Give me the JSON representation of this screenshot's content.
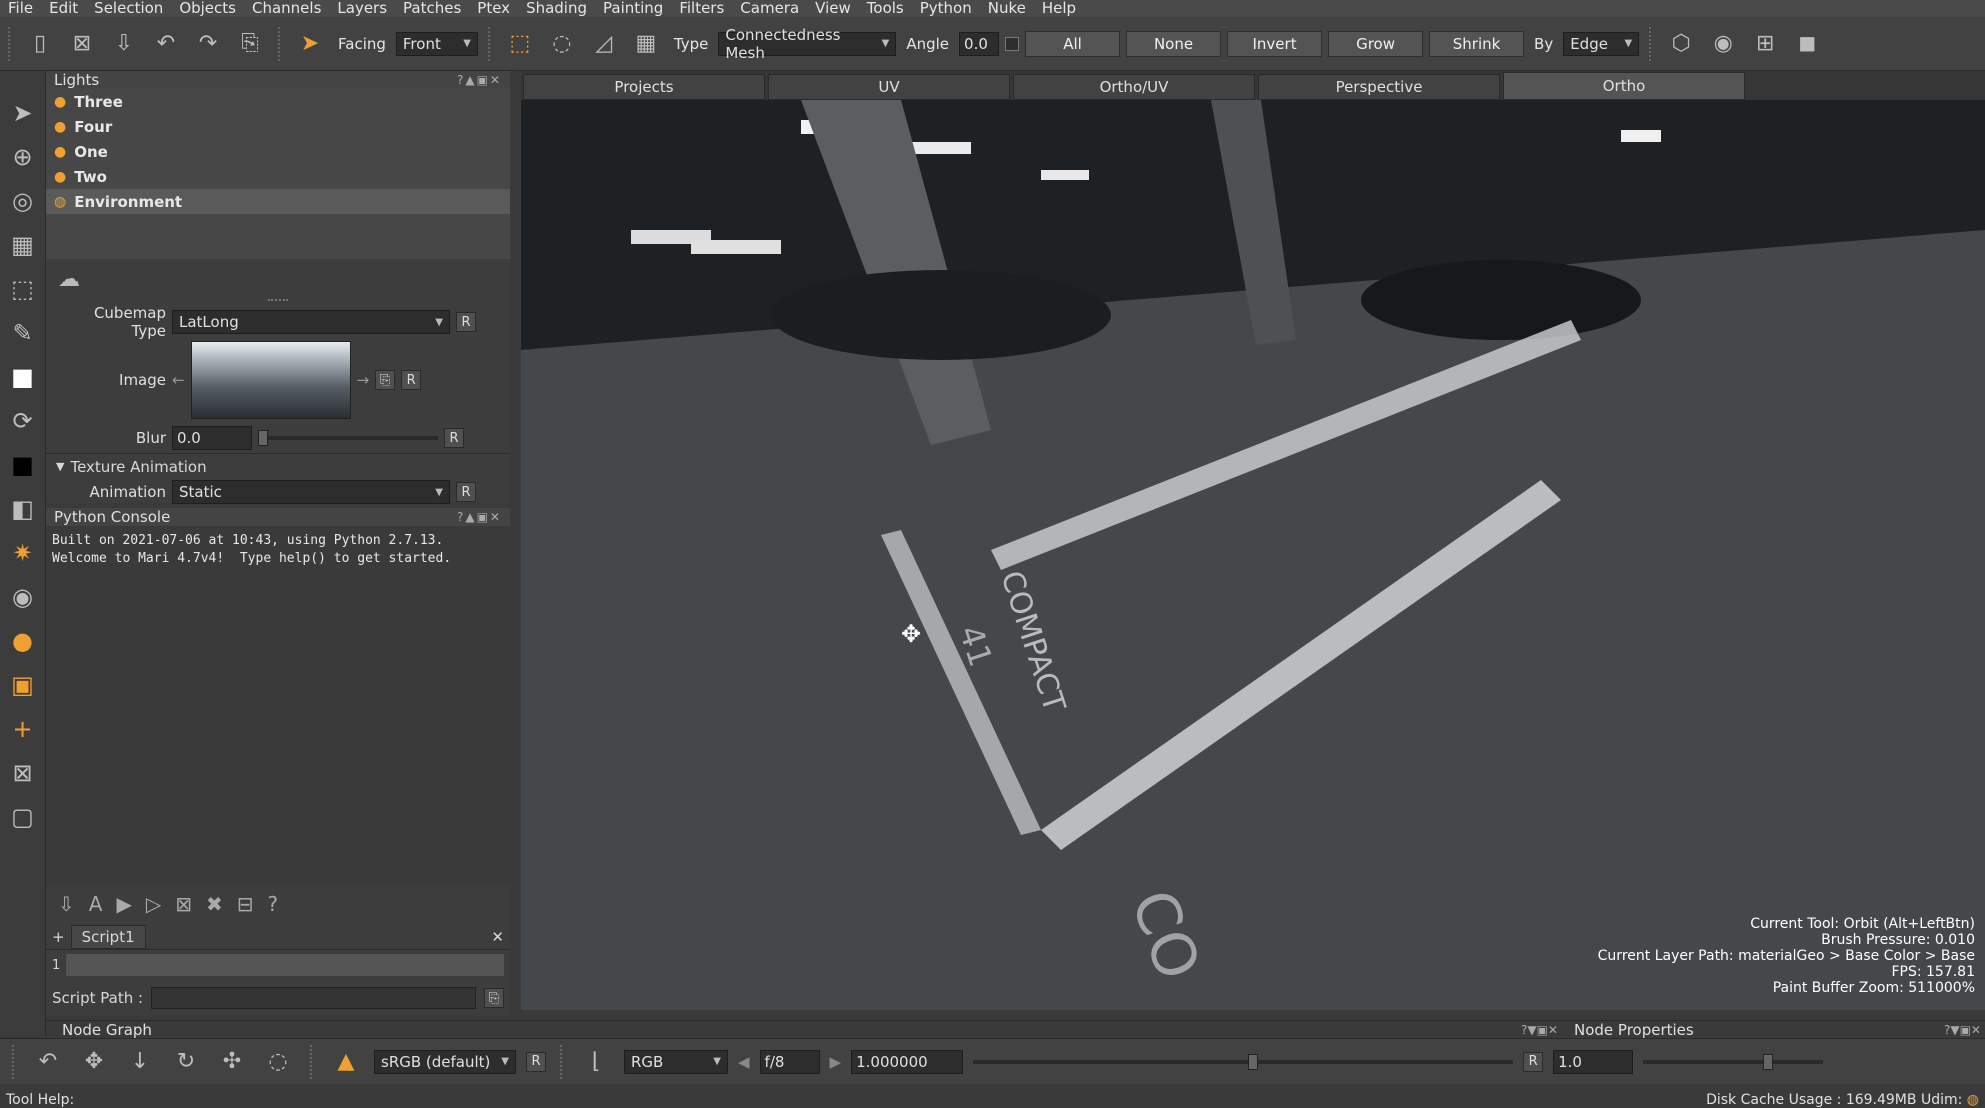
{
  "menu": [
    "File",
    "Edit",
    "Selection",
    "Objects",
    "Channels",
    "Layers",
    "Patches",
    "Ptex",
    "Shading",
    "Painting",
    "Filters",
    "Camera",
    "View",
    "Tools",
    "Python",
    "Nuke",
    "Help"
  ],
  "toolbar": {
    "facing_label": "Facing",
    "facing_value": "Front",
    "type_label": "Type",
    "type_value": "Connectedness Mesh",
    "angle_label": "Angle",
    "angle_value": "0.0",
    "btn_all": "All",
    "btn_none": "None",
    "btn_invert": "Invert",
    "btn_grow": "Grow",
    "btn_shrink": "Shrink",
    "by_label": "By",
    "by_value": "Edge"
  },
  "lights": {
    "title": "Lights",
    "items": [
      {
        "label": "Three"
      },
      {
        "label": "Four"
      },
      {
        "label": "One"
      },
      {
        "label": "Two"
      },
      {
        "label": "Environment"
      }
    ]
  },
  "env_props": {
    "cubemap_label": "Cubemap Type",
    "cubemap_value": "LatLong",
    "image_label": "Image",
    "blur_label": "Blur",
    "blur_value": "0.0",
    "tex_anim_label": "Texture Animation",
    "anim_label": "Animation",
    "anim_value": "Static",
    "r": "R"
  },
  "python_console": {
    "title": "Python Console",
    "text": "Built on 2021-07-06 at 10:43, using Python 2.7.13.\nWelcome to Mari 4.7v4!  Type help() to get started.",
    "script_tab": "Script1",
    "line_number": "1",
    "script_path_label": "Script Path :"
  },
  "viewport": {
    "tabs": [
      "Projects",
      "UV",
      "Ortho/UV",
      "Perspective",
      "Ortho"
    ],
    "hud": [
      "Current Tool: Orbit (Alt+LeftBtn)",
      "Brush Pressure: 0.010",
      "Current Layer Path: materialGeo > Base Color > Base",
      "FPS: 157.81",
      "Paint Buffer Zoom: 511000%"
    ],
    "floor_text_1": "COMPACT",
    "floor_text_2": "41",
    "floor_text_3": "CO"
  },
  "bottom_panels": {
    "node_graph": "Node Graph",
    "node_properties": "Node Properties"
  },
  "bottombar": {
    "colorspace": "sRGB (default)",
    "r": "R",
    "channel": "RGB",
    "fstop": "f/8",
    "exposure": "1.000000",
    "r2": "R",
    "gain": "1.0"
  },
  "status": {
    "tool_help": "Tool Help:",
    "disk_cache": "Disk Cache Usage : 169.49MB  Udim:"
  },
  "colors": {
    "accent": "#f0a030",
    "panel": "#3d3d3d"
  }
}
